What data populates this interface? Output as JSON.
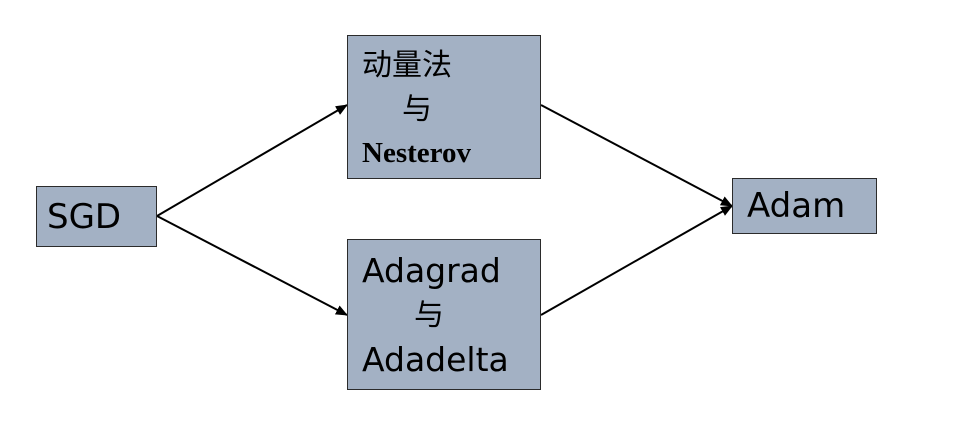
{
  "nodes": {
    "sgd": {
      "label": "SGD"
    },
    "momentum": {
      "line1": "动量法",
      "line2": "与",
      "line3": "Nesterov"
    },
    "adaptive": {
      "line1": "Adagrad",
      "line2": "与",
      "line3": "Adadelta"
    },
    "adam": {
      "label": "Adam"
    }
  },
  "edges": [
    {
      "from": "sgd",
      "to": "momentum"
    },
    {
      "from": "sgd",
      "to": "adaptive"
    },
    {
      "from": "momentum",
      "to": "adam"
    },
    {
      "from": "adaptive",
      "to": "adam"
    }
  ],
  "colors": {
    "node_fill": "#a3b1c4",
    "node_border": "#2b2b2b",
    "edge": "#000000"
  }
}
